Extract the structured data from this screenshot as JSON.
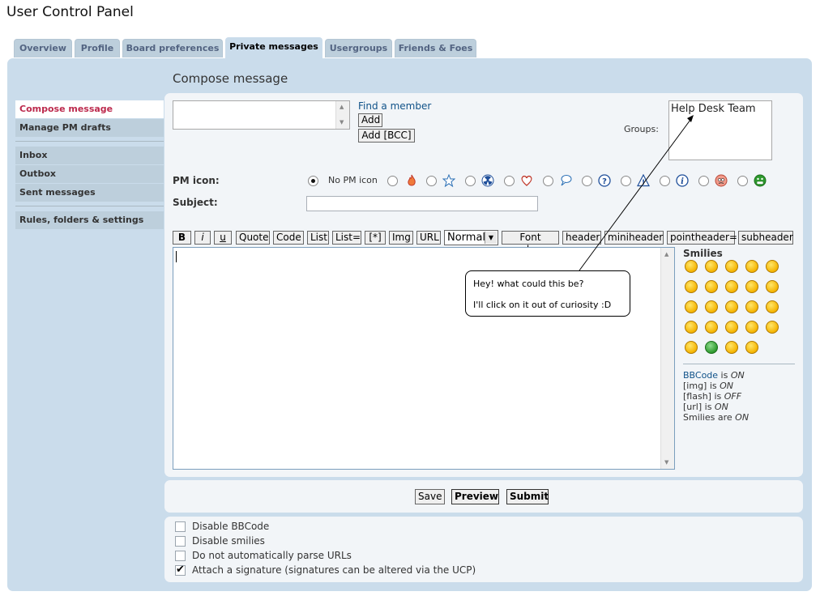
{
  "page": {
    "title": "User Control Panel"
  },
  "tabs": [
    {
      "label": "Overview"
    },
    {
      "label": "Profile"
    },
    {
      "label": "Board preferences"
    },
    {
      "label": "Private messages",
      "active": true
    },
    {
      "label": "Usergroups"
    },
    {
      "label": "Friends & Foes"
    }
  ],
  "heading": "Compose message",
  "sidebar": {
    "items": [
      {
        "label": "Compose message",
        "active": true
      },
      {
        "label": "Manage PM drafts"
      },
      {
        "label": "Inbox"
      },
      {
        "label": "Outbox"
      },
      {
        "label": "Sent messages"
      },
      {
        "label": "Rules, folders & settings"
      }
    ]
  },
  "recipients": {
    "find_member": "Find a member",
    "add": "Add",
    "add_bcc": "Add [BCC]",
    "groups_label": "Groups:",
    "groups_options": [
      "Help Desk Team"
    ]
  },
  "pm_icon": {
    "label": "PM icon:",
    "none_label": "No PM icon",
    "selected": "none",
    "icons": [
      "fire-icon",
      "star-icon",
      "radioactive-icon",
      "heart-icon",
      "speech-bubble-icon",
      "question-icon",
      "warning-icon",
      "info-icon",
      "mad-smiley-icon",
      "grin-smiley-icon"
    ]
  },
  "subject": {
    "label": "Subject:",
    "value": ""
  },
  "bbcode_buttons": [
    "B",
    "i",
    "u",
    "Quote",
    "Code",
    "List",
    "List=",
    "[*]",
    "Img",
    "URL"
  ],
  "font_size": {
    "selected": "Normal"
  },
  "bbcode_buttons2": [
    "Font colour",
    "header",
    "miniheader",
    "pointheader=",
    "subheader"
  ],
  "message": {
    "value": ""
  },
  "tooltip": {
    "line1": "Hey! what could this be?",
    "line2": "I'll click on it out of curiosity :D"
  },
  "smilies": {
    "title": "Smilies",
    "count": 24
  },
  "status": {
    "bbcode": {
      "label": "BBCode",
      "text": " is ",
      "state": "ON"
    },
    "img": {
      "label": "[img]",
      "text": " is ",
      "state": "ON"
    },
    "flash": {
      "label": "[flash]",
      "text": " is ",
      "state": "OFF"
    },
    "url": {
      "label": "[url]",
      "text": " is ",
      "state": "ON"
    },
    "smilies": {
      "label": "Smilies",
      "text": " are ",
      "state": "ON"
    }
  },
  "actions": {
    "save": "Save",
    "preview": "Preview",
    "submit": "Submit"
  },
  "options": [
    {
      "label": "Disable BBCode",
      "checked": false
    },
    {
      "label": "Disable smilies",
      "checked": false
    },
    {
      "label": "Do not automatically parse URLs",
      "checked": false
    },
    {
      "label": "Attach a signature (signatures can be altered via the UCP)",
      "checked": true
    }
  ],
  "colors": {
    "panel": "#cadceb",
    "nav_active_text": "#bc2a4d",
    "link": "#105289"
  }
}
